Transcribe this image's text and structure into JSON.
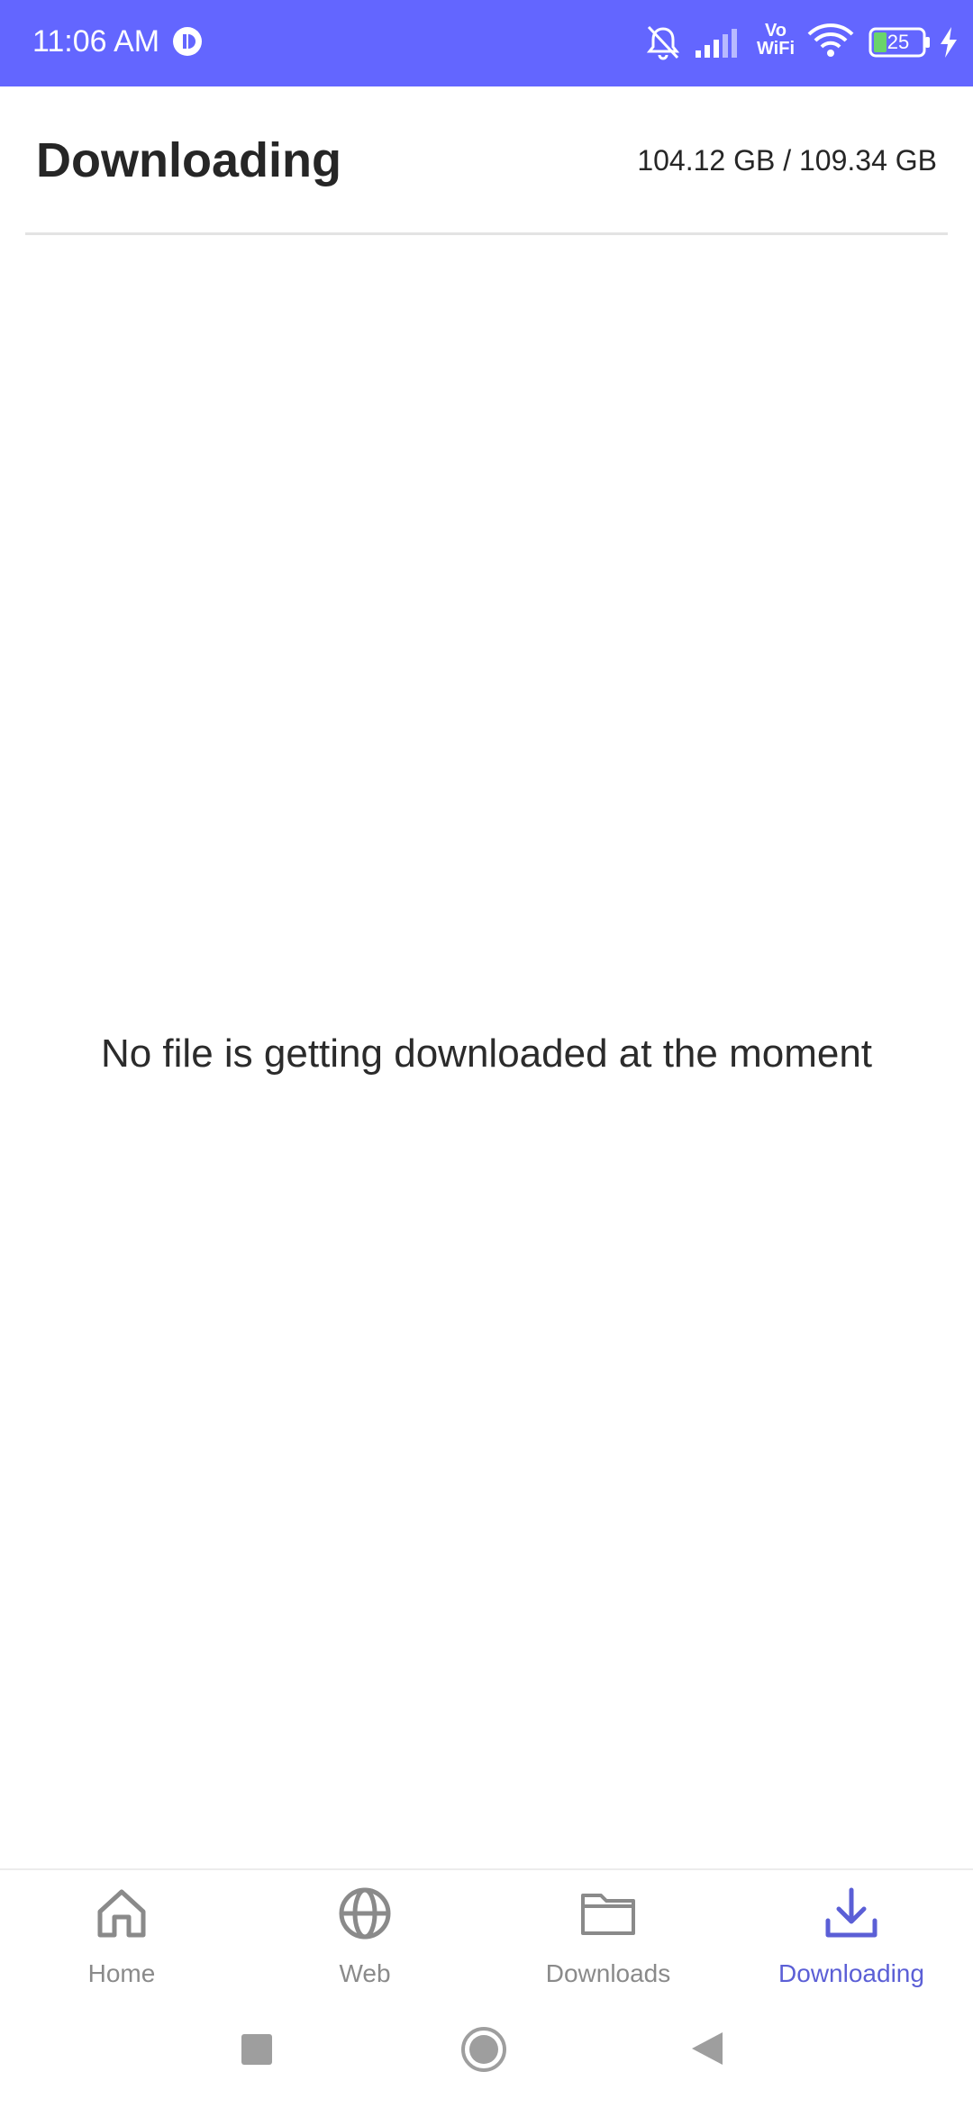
{
  "status_bar": {
    "time": "11:06 AM",
    "vowifi_label": "Vo\nWiFi",
    "battery_level": "25",
    "background_color": "#6366ff"
  },
  "header": {
    "title": "Downloading",
    "storage": "104.12 GB / 109.34 GB"
  },
  "main": {
    "empty_message": "No file is getting downloaded at the moment"
  },
  "bottom_nav": {
    "items": [
      {
        "label": "Home",
        "icon": "home-icon",
        "active": false
      },
      {
        "label": "Web",
        "icon": "globe-icon",
        "active": false
      },
      {
        "label": "Downloads",
        "icon": "folder-icon",
        "active": false
      },
      {
        "label": "Downloading",
        "icon": "download-icon",
        "active": true
      }
    ],
    "active_color": "#5b5fd6",
    "inactive_color": "#8a8a8a"
  },
  "system_nav": {
    "buttons": [
      "recent-apps",
      "home",
      "back"
    ]
  }
}
